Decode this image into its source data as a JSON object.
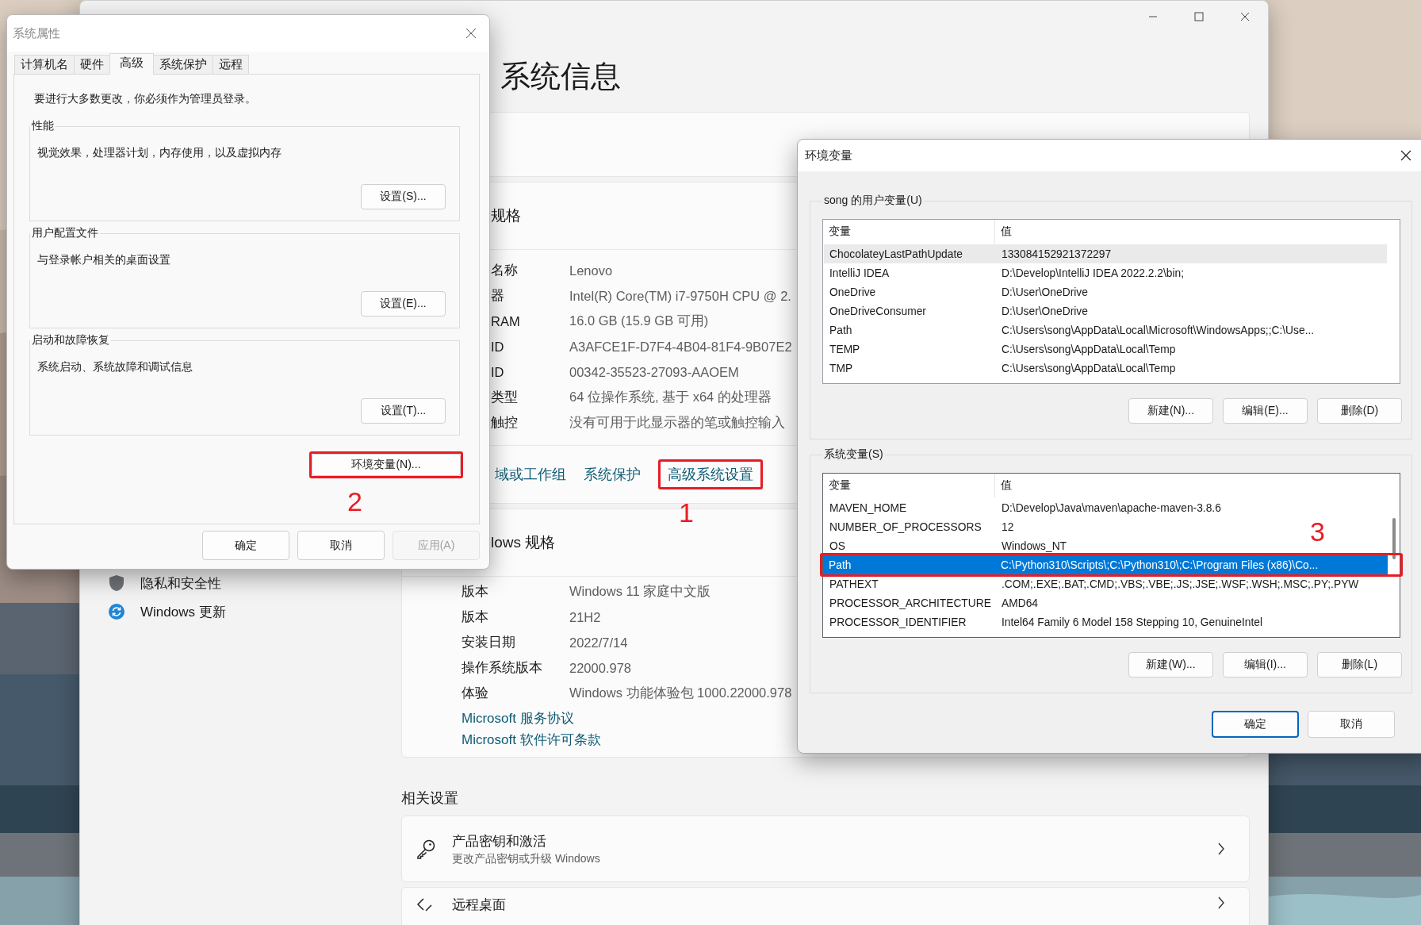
{
  "settings_window": {
    "sidebar": [
      {
        "label": "隐私和安全性"
      },
      {
        "label": "Windows 更新"
      }
    ],
    "heading": "系统信息",
    "device_specs": {
      "title": "规格",
      "rows": [
        {
          "label": "名称",
          "value": "Lenovo"
        },
        {
          "label": "器",
          "value": "Intel(R) Core(TM) i7-9750H CPU @ 2."
        },
        {
          "label": "RAM",
          "value": "16.0 GB (15.9 GB 可用)"
        },
        {
          "label": "ID",
          "value": "A3AFCE1F-D7F4-4B04-81F4-9B07E2"
        },
        {
          "label": "ID",
          "value": "00342-35523-27093-AAOEM"
        },
        {
          "label": "类型",
          "value": "64 位操作系统, 基于 x64 的处理器"
        },
        {
          "label": "触控",
          "value": "没有可用于此显示器的笔或触控输入"
        }
      ],
      "links": [
        {
          "label": "域或工作组",
          "highlighted": false
        },
        {
          "label": "系统保护",
          "highlighted": false
        },
        {
          "label": "高级系统设置",
          "highlighted": true,
          "callout": "1"
        }
      ]
    },
    "windows_specs": {
      "title": "lows 规格",
      "rows": [
        {
          "label": "版本",
          "value": "Windows 11 家庭中文版"
        },
        {
          "label": "版本",
          "value": "21H2"
        },
        {
          "label": "安装日期",
          "value": "2022/7/14"
        },
        {
          "label": "操作系统版本",
          "value": "22000.978"
        },
        {
          "label": "体验",
          "value": "Windows 功能体验包 1000.22000.978"
        }
      ],
      "links": [
        "Microsoft 服务协议",
        "Microsoft 软件许可条款"
      ]
    },
    "related_heading": "相关设置",
    "related": [
      {
        "title": "产品密钥和激活",
        "subtitle": "更改产品密钥或升级 Windows"
      },
      {
        "title": "远程桌面"
      }
    ]
  },
  "system_properties": {
    "title": "系统属性",
    "tabs": [
      {
        "label": "计算机名",
        "selected": false
      },
      {
        "label": "硬件",
        "selected": false
      },
      {
        "label": "高级",
        "selected": true
      },
      {
        "label": "系统保护",
        "selected": false
      },
      {
        "label": "远程",
        "selected": false
      }
    ],
    "notice": "要进行大多数更改，你必须作为管理员登录。",
    "groups": [
      {
        "title": "性能",
        "description": "视觉效果，处理器计划，内存使用，以及虚拟内存",
        "button": "设置(S)..."
      },
      {
        "title": "用户配置文件",
        "description": "与登录帐户相关的桌面设置",
        "button": "设置(E)..."
      },
      {
        "title": "启动和故障恢复",
        "description": "系统启动、系统故障和调试信息",
        "button": "设置(T)..."
      }
    ],
    "env_button": {
      "label": "环境变量(N)...",
      "highlighted": true,
      "callout": "2"
    },
    "buttons": [
      {
        "label": "确定",
        "disabled": false
      },
      {
        "label": "取消",
        "disabled": false
      },
      {
        "label": "应用(A)",
        "disabled": true
      }
    ]
  },
  "environment_variables": {
    "title": "环境变量",
    "groups": [
      {
        "label": "song 的用户变量(U)",
        "focused": false,
        "columns": [
          "变量",
          "值"
        ],
        "rows": [
          {
            "name": "ChocolateyLastPathUpdate",
            "value": "133084152921372297",
            "selected": true
          },
          {
            "name": "IntelliJ IDEA",
            "value": "D:\\Develop\\IntelliJ IDEA 2022.2.2\\bin;",
            "selected": false
          },
          {
            "name": "OneDrive",
            "value": "D:\\User\\OneDrive",
            "selected": false
          },
          {
            "name": "OneDriveConsumer",
            "value": "D:\\User\\OneDrive",
            "selected": false
          },
          {
            "name": "Path",
            "value": "C:\\Users\\song\\AppData\\Local\\Microsoft\\WindowsApps;;C:\\Use...",
            "selected": false
          },
          {
            "name": "TEMP",
            "value": "C:\\Users\\song\\AppData\\Local\\Temp",
            "selected": false
          },
          {
            "name": "TMP",
            "value": "C:\\Users\\song\\AppData\\Local\\Temp",
            "selected": false
          }
        ],
        "buttons": [
          "新建(N)...",
          "编辑(E)...",
          "删除(D)"
        ]
      },
      {
        "label": "系统变量(S)",
        "focused": true,
        "columns": [
          "变量",
          "值"
        ],
        "rows": [
          {
            "name": "MAVEN_HOME",
            "value": "D:\\Develop\\Java\\maven\\apache-maven-3.8.6",
            "selected": false
          },
          {
            "name": "NUMBER_OF_PROCESSORS",
            "value": "12",
            "selected": false
          },
          {
            "name": "OS",
            "value": "Windows_NT",
            "selected": false
          },
          {
            "name": "Path",
            "value": "C:\\Python310\\Scripts\\;C:\\Python310\\;C:\\Program Files (x86)\\Co...",
            "selected": true,
            "highlighted": true,
            "callout": "3"
          },
          {
            "name": "PATHEXT",
            "value": ".COM;.EXE;.BAT;.CMD;.VBS;.VBE;.JS;.JSE;.WSF;.WSH;.MSC;.PY;.PYW",
            "selected": false
          },
          {
            "name": "PROCESSOR_ARCHITECTURE",
            "value": "AMD64",
            "selected": false
          },
          {
            "name": "PROCESSOR_IDENTIFIER",
            "value": "Intel64 Family 6 Model 158 Stepping 10, GenuineIntel",
            "selected": false
          }
        ],
        "buttons": [
          "新建(W)...",
          "编辑(I)...",
          "删除(L)"
        ]
      }
    ],
    "buttons": [
      {
        "label": "确定",
        "default": true
      },
      {
        "label": "取消",
        "default": false
      }
    ]
  }
}
